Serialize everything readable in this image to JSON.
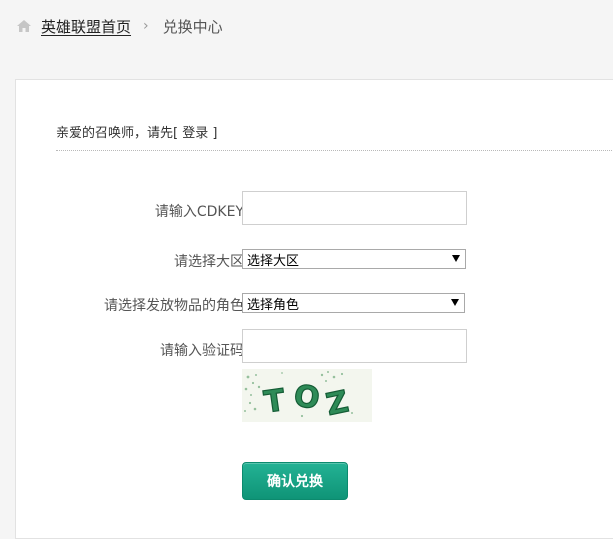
{
  "breadcrumb": {
    "home_label": "英雄联盟首页",
    "separator": "›",
    "current_label": "兑换中心"
  },
  "notice": {
    "prefix": "亲爱的召唤师，请先",
    "bracket_open": "[ ",
    "login_label": "登录",
    "bracket_close": " ]"
  },
  "form": {
    "cdkey_label": "请输入CDKEY：",
    "cdkey_value": "",
    "region_label": "请选择大区：",
    "region_selected": "选择大区",
    "role_label": "请选择发放物品的角色：",
    "role_selected": "选择角色",
    "captcha_label": "请输入验证码：",
    "captcha_value": "",
    "captcha_text": "TOZ",
    "submit_label": "确认兑换"
  },
  "colors": {
    "accent": "#14a283",
    "captcha_green": "#2e8b57"
  }
}
